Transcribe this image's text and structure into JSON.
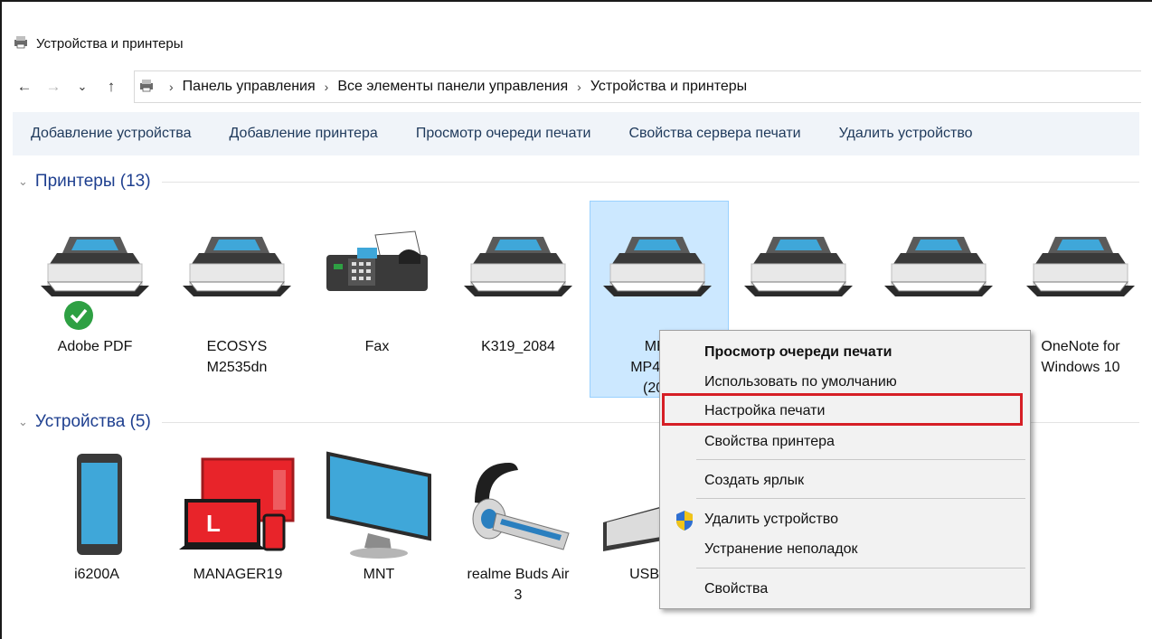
{
  "window": {
    "title": "Устройства и принтеры"
  },
  "address": {
    "crumbs": [
      "Панель управления",
      "Все элементы панели управления",
      "Устройства и принтеры"
    ]
  },
  "nav": {
    "back_icon": "←",
    "forward_icon": "→",
    "recent_icon": "⌄",
    "up_icon": "↑",
    "sep": "›"
  },
  "commands": [
    "Добавление устройства",
    "Добавление принтера",
    "Просмотр очереди печати",
    "Свойства сервера печати",
    "Удалить устройство"
  ],
  "printers_group": {
    "title": "Принтеры (13)",
    "chevron": "⌄"
  },
  "devices_group": {
    "title": "Устройства (5)",
    "chevron": "⌄"
  },
  "printers": [
    {
      "line1": "Adobe PDF",
      "line2": "",
      "line3": ""
    },
    {
      "line1": "ECOSYS",
      "line2": "M2535dn",
      "line3": ""
    },
    {
      "line1": "Fax",
      "line2": "",
      "line3": ""
    },
    {
      "line1": "K319_2084",
      "line2": "",
      "line3": ""
    },
    {
      "line1": "MEI",
      "line2": "MP4000",
      "line3": "(203"
    },
    {
      "line1": "",
      "line2": "",
      "line3": ""
    },
    {
      "line1": "",
      "line2": "",
      "line3": ""
    },
    {
      "line1": "OneNote for",
      "line2": "Windows 10",
      "line3": ""
    }
  ],
  "devices": [
    {
      "line1": "i6200A",
      "line2": ""
    },
    {
      "line1": "MANAGER19",
      "line2": ""
    },
    {
      "line1": "MNT",
      "line2": ""
    },
    {
      "line1": "realme Buds Air",
      "line2": "3"
    },
    {
      "line1": "USB Re",
      "line2": ""
    }
  ],
  "manager_badge": "L",
  "context_menu": {
    "items": [
      "Просмотр очереди печати",
      "Использовать по умолчанию",
      "Настройка печати",
      "Свойства принтера",
      "Создать ярлык",
      "Удалить устройство",
      "Устранение неполадок",
      "Свойства"
    ],
    "highlighted": "Настройка печати"
  },
  "colors": {
    "selection": "#cce8ff",
    "highlight_border": "#d61f26",
    "link_blue": "#1e3f8f",
    "default_check": "#2ea043"
  }
}
